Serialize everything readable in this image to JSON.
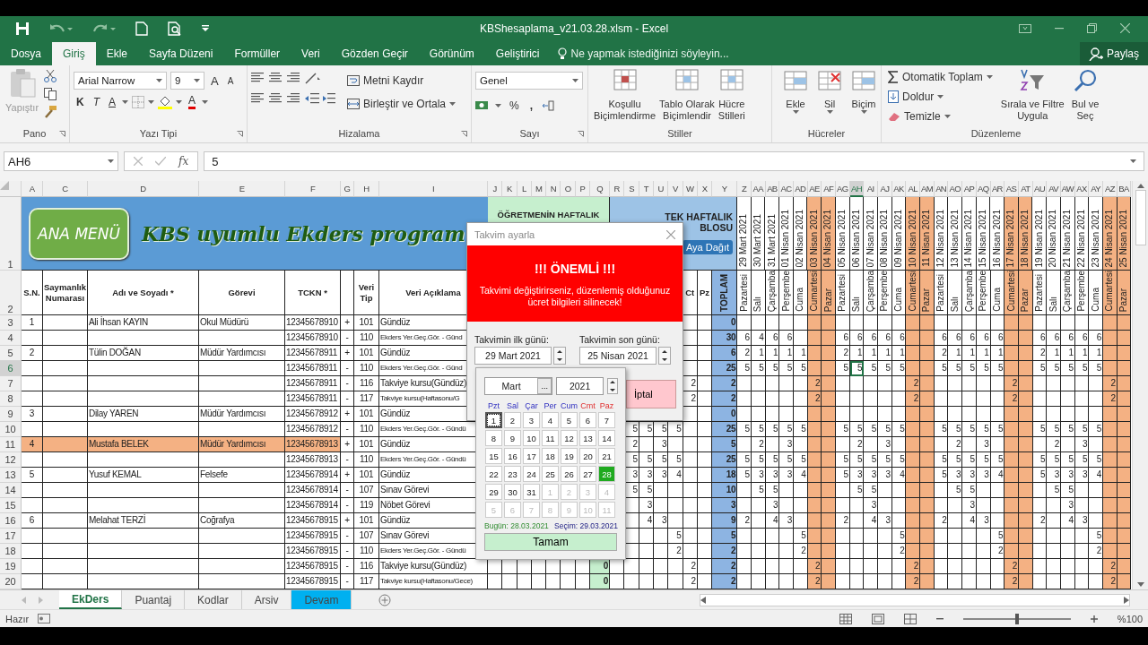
{
  "title_bar": {
    "title": "KBShesaplama_v21.03.28.xlsm - Excel"
  },
  "menu_tabs": [
    {
      "label": "Dosya",
      "selected": false
    },
    {
      "label": "Giriş",
      "selected": true
    },
    {
      "label": "Ekle",
      "selected": false
    },
    {
      "label": "Sayfa Düzeni",
      "selected": false
    },
    {
      "label": "Formüller",
      "selected": false
    },
    {
      "label": "Veri",
      "selected": false
    },
    {
      "label": "Gözden Geçir",
      "selected": false
    },
    {
      "label": "Görünüm",
      "selected": false
    },
    {
      "label": "Geliştirici",
      "selected": false
    }
  ],
  "tell_me": {
    "placeholder": "Ne yapmak istediğinizi söyleyin..."
  },
  "share": "Paylaş",
  "ribbon": {
    "clipboard": {
      "label": "Pano",
      "paste": "Yapıştır"
    },
    "font": {
      "label": "Yazı Tipi",
      "font_name": "Arial Narrow",
      "font_size": "9",
      "grow": "A",
      "shrink": "A",
      "bold": "K",
      "italic": "T",
      "underline": "A",
      "font_color": "A"
    },
    "alignment": {
      "label": "Hizalama",
      "wrap": "Metni Kaydır",
      "merge": "Birleştir ve Ortala"
    },
    "number": {
      "label": "Sayı",
      "format": "Genel",
      "percent": "%",
      "comma": ","
    },
    "styles": {
      "label": "Stiller",
      "buttons": [
        [
          "Koşullu",
          "Biçimlendirme"
        ],
        [
          "Tablo Olarak",
          "Biçimlendir"
        ],
        [
          "Hücre",
          "Stilleri"
        ]
      ]
    },
    "cells": {
      "label": "Hücreler",
      "buttons": [
        "Ekle",
        "Sil",
        "Biçim"
      ]
    },
    "editing": {
      "label": "Düzenleme",
      "autosum": "Otomatik Toplam",
      "fill": "Doldur",
      "clear": "Temizle",
      "sort": [
        "Sırala ve Filtre",
        "Uygula"
      ],
      "find": [
        "Bul ve",
        "Seç"
      ]
    }
  },
  "formula_bar": {
    "name_box": "AH6",
    "fx": "fx",
    "value": "5"
  },
  "sheet": {
    "column_headers": [
      {
        "label": "A",
        "selected": false
      },
      {
        "label": "C",
        "selected": false
      },
      {
        "label": "D",
        "selected": false
      },
      {
        "label": "E",
        "selected": false
      },
      {
        "label": "F",
        "selected": false
      },
      {
        "label": "G",
        "selected": false
      },
      {
        "label": "H",
        "selected": false
      },
      {
        "label": "I",
        "selected": false
      },
      {
        "label": "J",
        "selected": false
      },
      {
        "label": "K",
        "selected": false
      },
      {
        "label": "L",
        "selected": false
      },
      {
        "label": "M",
        "selected": false
      },
      {
        "label": "N",
        "selected": false
      },
      {
        "label": "O",
        "selected": false
      },
      {
        "label": "P",
        "selected": false
      },
      {
        "label": "Q",
        "selected": false
      },
      {
        "label": "R",
        "selected": false
      },
      {
        "label": "S",
        "selected": false
      },
      {
        "label": "T",
        "selected": false
      },
      {
        "label": "U",
        "selected": false
      },
      {
        "label": "V",
        "selected": false
      },
      {
        "label": "W",
        "selected": false
      },
      {
        "label": "X",
        "selected": false
      },
      {
        "label": "Y",
        "selected": false
      },
      {
        "label": "Z",
        "selected": false
      },
      {
        "label": "AA",
        "selected": false
      },
      {
        "label": "AB",
        "selected": false
      },
      {
        "label": "AC",
        "selected": false
      },
      {
        "label": "AD",
        "selected": false
      },
      {
        "label": "AE",
        "selected": false
      },
      {
        "label": "AF",
        "selected": false
      },
      {
        "label": "AG",
        "selected": false
      },
      {
        "label": "AH",
        "selected": true
      },
      {
        "label": "AI",
        "selected": false
      },
      {
        "label": "AJ",
        "selected": false
      },
      {
        "label": "AK",
        "selected": false
      },
      {
        "label": "AL",
        "selected": false
      },
      {
        "label": "AM",
        "selected": false
      },
      {
        "label": "AN",
        "selected": false
      },
      {
        "label": "AO",
        "selected": false
      },
      {
        "label": "AP",
        "selected": false
      },
      {
        "label": "AQ",
        "selected": false
      },
      {
        "label": "AR",
        "selected": false
      },
      {
        "label": "AS",
        "selected": false
      },
      {
        "label": "AT",
        "selected": false
      },
      {
        "label": "AU",
        "selected": false
      },
      {
        "label": "AV",
        "selected": false
      },
      {
        "label": "AW",
        "selected": false
      },
      {
        "label": "AX",
        "selected": false
      },
      {
        "label": "AY",
        "selected": false
      },
      {
        "label": "AZ",
        "selected": false
      },
      {
        "label": "BA",
        "selected": false
      }
    ],
    "banner": {
      "row_number": "1",
      "menu_button": "ANA MENÜ",
      "title": "KBS uyumlu Ekders program",
      "band_1": "ÖĞRETMENİN HAFTALIK",
      "band_2_top": "TEK HAFTALIK",
      "band_2_bottom": "BLOSU",
      "distribute_button": "Aya Dağıt"
    },
    "header_row": {
      "row_number": "2",
      "sn": "S.N.",
      "account": "Saymanlık Numarası",
      "name": "Adı ve Soyadı *",
      "role": "Görevi",
      "tckn": "TCKN *",
      "type": "Veri Tip",
      "desc": "Veri Açıklama",
      "col_w": "Ct",
      "col_x": "Pz",
      "total": "TOPLAM"
    },
    "days": [
      {
        "date": "29 Mart 2021",
        "day": "Pazartesi",
        "weekend": false
      },
      {
        "date": "30 Mart 2021",
        "day": "Salı",
        "weekend": false
      },
      {
        "date": "31 Mart 2021",
        "day": "Çarşamba",
        "weekend": false
      },
      {
        "date": "01 Nisan 2021",
        "day": "Perşembe",
        "weekend": false
      },
      {
        "date": "02 Nisan 2021",
        "day": "Cuma",
        "weekend": false
      },
      {
        "date": "03 Nisan 2021",
        "day": "Cumartesi",
        "weekend": true
      },
      {
        "date": "04 Nisan 2021",
        "day": "Pazar",
        "weekend": true
      },
      {
        "date": "05 Nisan 2021",
        "day": "Pazartesi",
        "weekend": false
      },
      {
        "date": "06 Nisan 2021",
        "day": "Salı",
        "weekend": false
      },
      {
        "date": "07 Nisan 2021",
        "day": "Çarşamba",
        "weekend": false
      },
      {
        "date": "08 Nisan 2021",
        "day": "Perşembe",
        "weekend": false
      },
      {
        "date": "09 Nisan 2021",
        "day": "Cuma",
        "weekend": false
      },
      {
        "date": "10 Nisan 2021",
        "day": "Cumartesi",
        "weekend": true
      },
      {
        "date": "11 Nisan 2021",
        "day": "Pazar",
        "weekend": true
      },
      {
        "date": "12 Nisan 2021",
        "day": "Pazartesi",
        "weekend": false
      },
      {
        "date": "13 Nisan 2021",
        "day": "Salı",
        "weekend": false
      },
      {
        "date": "14 Nisan 2021",
        "day": "Çarşamba",
        "weekend": false
      },
      {
        "date": "15 Nisan 2021",
        "day": "Perşembe",
        "weekend": false
      },
      {
        "date": "16 Nisan 2021",
        "day": "Cuma",
        "weekend": false
      },
      {
        "date": "17 Nisan 2021",
        "day": "Cumartesi",
        "weekend": true
      },
      {
        "date": "18 Nisan 2021",
        "day": "Pazar",
        "weekend": true
      },
      {
        "date": "19 Nisan 2021",
        "day": "Pazartesi",
        "weekend": false
      },
      {
        "date": "20 Nisan 2021",
        "day": "Salı",
        "weekend": false
      },
      {
        "date": "21 Nisan 2021",
        "day": "Çarşamba",
        "weekend": false
      },
      {
        "date": "22 Nisan 2021",
        "day": "Perşembe",
        "weekend": false
      },
      {
        "date": "23 Nisan 2021",
        "day": "Cuma",
        "weekend": false
      },
      {
        "date": "24 Nisan 2021",
        "day": "Cumartesi",
        "weekend": true
      },
      {
        "date": "25 Nisan 2021",
        "day": "Pazar",
        "weekend": true
      }
    ],
    "rows": [
      {
        "number": "3",
        "selected": false,
        "highlighted": false,
        "sn": "1",
        "name": "Ali İhsan KAYIN",
        "role": "Okul Müdürü",
        "tckn": "12345678910",
        "sign": "+",
        "type": "101",
        "desc": "Gündüz",
        "total": "0"
      },
      {
        "number": "4",
        "selected": false,
        "highlighted": false,
        "tckn": "12345678910",
        "sign": "-",
        "type": "110",
        "desc": "Ekders Yer.Geç.Gör. - Günd",
        "total": "30",
        "weeks": [
          {
            "mon": "6",
            "tue": "4",
            "wed": "6",
            "thu": "6"
          },
          {
            "mon": "6",
            "tue": "6",
            "wed": "6",
            "thu": "6",
            "fri": "6"
          },
          {
            "mon": "6",
            "tue": "6",
            "wed": "6",
            "thu": "6",
            "fri": "6"
          },
          {
            "mon": "6",
            "tue": "6",
            "wed": "6",
            "thu": "6",
            "fri": "6"
          }
        ]
      },
      {
        "number": "5",
        "selected": false,
        "highlighted": false,
        "sn": "2",
        "name": "Tülin DOĞAN",
        "role": "Müdür Yardımcısı",
        "tckn": "12345678911",
        "sign": "+",
        "type": "101",
        "desc": "Gündüz",
        "total": "6",
        "weeks": [
          {
            "mon": "2",
            "tue": "1",
            "wed": "1",
            "thu": "1",
            "fri": "1"
          },
          {
            "mon": "2",
            "tue": "1",
            "wed": "1",
            "thu": "1",
            "fri": "1"
          },
          {
            "mon": "2",
            "tue": "1",
            "wed": "1",
            "thu": "1",
            "fri": "1"
          },
          {
            "mon": "2",
            "tue": "1",
            "wed": "1",
            "thu": "1",
            "fri": "1"
          }
        ]
      },
      {
        "number": "6",
        "selected": true,
        "highlighted": false,
        "tckn": "12345678911",
        "sign": "-",
        "type": "110",
        "desc": "Ekders Yer.Geç.Gör. - Günd",
        "total": "25",
        "weeks": [
          {
            "mon": "5",
            "tue": "5",
            "wed": "5",
            "thu": "5",
            "fri": "5"
          },
          {
            "mon": "5",
            "tue": "5",
            "wed": "5",
            "thu": "5",
            "fri": "5"
          },
          {
            "mon": "5",
            "tue": "5",
            "wed": "5",
            "thu": "5",
            "fri": "5"
          },
          {
            "mon": "5",
            "tue": "5",
            "wed": "5",
            "thu": "5",
            "fri": "5"
          }
        ]
      },
      {
        "number": "7",
        "selected": false,
        "highlighted": false,
        "tckn": "12345678911",
        "sign": "-",
        "type": "116",
        "desc": "Takviye kursu(Gündüz)",
        "cells": {
          "W": "2"
        },
        "total": "2",
        "weeks": [
          {
            "sat": "2"
          },
          {
            "sat": "2"
          },
          {
            "sat": "2"
          },
          {
            "sat": "2"
          }
        ]
      },
      {
        "number": "8",
        "selected": false,
        "highlighted": false,
        "tckn": "12345678911",
        "sign": "-",
        "type": "117",
        "desc": "Takviye kursu(Haftasonu/G",
        "cells": {
          "W": "2"
        },
        "total": "2",
        "weeks": [
          {
            "sat": "2"
          },
          {
            "sat": "2"
          },
          {
            "sat": "2"
          },
          {
            "sat": "2"
          }
        ]
      },
      {
        "number": "9",
        "selected": false,
        "highlighted": false,
        "sn": "3",
        "name": "Dilay YAREN",
        "role": "Müdür Yardımcısı",
        "tckn": "12345678912",
        "sign": "+",
        "type": "101",
        "desc": "Gündüz",
        "total": "0"
      },
      {
        "number": "10",
        "selected": false,
        "highlighted": false,
        "tckn": "12345678912",
        "sign": "-",
        "type": "110",
        "desc": "Ekders Yer.Geç.Gör. - Gündü",
        "cells": {
          "S": "5",
          "T": "5",
          "U": "5",
          "V": "5"
        },
        "total": "25",
        "weeks": [
          {
            "mon": "5",
            "tue": "5",
            "wed": "5",
            "thu": "5",
            "fri": "5"
          },
          {
            "mon": "5",
            "tue": "5",
            "wed": "5",
            "thu": "5",
            "fri": "5"
          },
          {
            "mon": "5",
            "tue": "5",
            "wed": "5",
            "thu": "5",
            "fri": "5"
          },
          {
            "mon": "5",
            "tue": "5",
            "wed": "5",
            "thu": "5",
            "fri": "5"
          }
        ]
      },
      {
        "number": "11",
        "selected": false,
        "highlighted": true,
        "sn": "4",
        "name": "Mustafa BELEK",
        "role": "Müdür Yardımcısı",
        "tckn": "12345678913",
        "sign": "+",
        "type": "101",
        "desc": "Gündüz",
        "cells": {
          "S": "2",
          "U": "3"
        },
        "total": "5",
        "weeks": [
          {
            "tue": "2",
            "thu": "3"
          },
          {
            "tue": "2",
            "thu": "3"
          },
          {
            "tue": "2",
            "thu": "3"
          },
          {
            "tue": "2",
            "thu": "3"
          }
        ]
      },
      {
        "number": "12",
        "selected": false,
        "highlighted": false,
        "tckn": "12345678913",
        "sign": "-",
        "type": "110",
        "desc": "Ekders Yer.Geç.Gör. - Gündü",
        "cells": {
          "S": "5",
          "T": "5",
          "U": "5",
          "V": "5"
        },
        "total": "25",
        "weeks": [
          {
            "mon": "5",
            "tue": "5",
            "wed": "5",
            "thu": "5",
            "fri": "5"
          },
          {
            "mon": "5",
            "tue": "5",
            "wed": "5",
            "thu": "5",
            "fri": "5"
          },
          {
            "mon": "5",
            "tue": "5",
            "wed": "5",
            "thu": "5",
            "fri": "5"
          },
          {
            "mon": "5",
            "tue": "5",
            "wed": "5",
            "thu": "5",
            "fri": "5"
          }
        ]
      },
      {
        "number": "13",
        "selected": false,
        "highlighted": false,
        "sn": "5",
        "name": "Yusuf KEMAL",
        "role": "Felsefe",
        "tckn": "12345678914",
        "sign": "+",
        "type": "101",
        "desc": "Gündüz",
        "cells": {
          "S": "3",
          "T": "3",
          "U": "3",
          "V": "4"
        },
        "total": "18",
        "weeks": [
          {
            "mon": "5",
            "tue": "3",
            "wed": "3",
            "thu": "3",
            "fri": "4"
          },
          {
            "mon": "5",
            "tue": "3",
            "wed": "3",
            "thu": "3",
            "fri": "4"
          },
          {
            "mon": "5",
            "tue": "3",
            "wed": "3",
            "thu": "3",
            "fri": "4"
          },
          {
            "mon": "5",
            "tue": "3",
            "wed": "3",
            "thu": "3",
            "fri": "4"
          }
        ]
      },
      {
        "number": "14",
        "selected": false,
        "highlighted": false,
        "tckn": "12345678914",
        "sign": "-",
        "type": "107",
        "desc": "Sınav Görevi",
        "cells": {
          "S": "5",
          "T": "5"
        },
        "total": "10",
        "weeks": [
          {
            "tue": "5",
            "wed": "5"
          },
          {
            "tue": "5",
            "wed": "5"
          },
          {
            "tue": "5",
            "wed": "5"
          },
          {
            "tue": "5",
            "wed": "5"
          }
        ]
      },
      {
        "number": "15",
        "selected": false,
        "highlighted": false,
        "tckn": "12345678914",
        "sign": "-",
        "type": "119",
        "desc": "Nöbet Görevi",
        "cells": {
          "T": "3"
        },
        "total": "3",
        "weeks": [
          {
            "wed": "3"
          },
          {
            "wed": "3"
          },
          {
            "wed": "3"
          },
          {
            "wed": "3"
          }
        ]
      },
      {
        "number": "16",
        "selected": false,
        "highlighted": false,
        "sn": "6",
        "name": "Melahat TERZİ",
        "role": "Coğrafya",
        "tckn": "12345678915",
        "sign": "+",
        "type": "101",
        "desc": "Gündüz",
        "cells": {
          "T": "4",
          "U": "3"
        },
        "total": "9",
        "weeks": [
          {
            "mon": "2",
            "wed": "4",
            "thu": "3"
          },
          {
            "mon": "2",
            "wed": "4",
            "thu": "3"
          },
          {
            "mon": "2",
            "wed": "4",
            "thu": "3"
          },
          {
            "mon": "2",
            "wed": "4",
            "thu": "3"
          }
        ]
      },
      {
        "number": "17",
        "selected": false,
        "highlighted": false,
        "tckn": "12345678915",
        "sign": "-",
        "type": "107",
        "desc": "Sınav Görevi",
        "cells": {
          "V": "5"
        },
        "total": "5",
        "weeks": [
          {
            "fri": "5"
          },
          {
            "fri": "5"
          },
          {
            "fri": "5"
          },
          {
            "fri": "5"
          }
        ]
      },
      {
        "number": "18",
        "selected": false,
        "highlighted": false,
        "tckn": "12345678915",
        "sign": "-",
        "type": "110",
        "desc": "Ekders Yer.Geç.Gör. - Gündü",
        "cells": {
          "V": "2"
        },
        "total": "2",
        "weeks": [
          {
            "fri": "2"
          },
          {
            "fri": "2"
          },
          {
            "fri": "2"
          },
          {
            "fri": "2"
          }
        ]
      },
      {
        "number": "19",
        "selected": false,
        "highlighted": false,
        "tckn": "12345678915",
        "sign": "-",
        "type": "116",
        "desc": "Takviye kursu(Gündüz)",
        "cells": {
          "Q": "0",
          "W": "2"
        },
        "total": "2",
        "weeks": [
          {
            "sat": "2"
          },
          {
            "sat": "2"
          },
          {
            "sat": "2"
          },
          {
            "sat": "2"
          }
        ]
      },
      {
        "number": "20",
        "selected": false,
        "highlighted": false,
        "tckn": "12345678915",
        "sign": "-",
        "type": "117",
        "desc": "Takviye kursu(Haftasonu/Gece)",
        "cells": {
          "Q": "0",
          "W": "2"
        },
        "total": "2",
        "weeks": [
          {
            "sat": "2"
          },
          {
            "sat": "2"
          },
          {
            "sat": "2"
          },
          {
            "sat": "2"
          }
        ]
      }
    ]
  },
  "dialog": {
    "title": "Takvim ayarla",
    "warning_title": "!!! ÖNEMLİ !!!",
    "warning_text": "Takvimi değiştirirseniz, düzenlemiş olduğunuz ücret bilgileri silinecek!",
    "start_label": "Takvimin ilk günü:",
    "start_value": "29 Mart 2021",
    "end_label": "Takvimin son günü:",
    "end_value": "25 Nisan 2021",
    "cancel": "İptal"
  },
  "calendar": {
    "month": "Mart",
    "more": "...",
    "year": "2021",
    "weekdays": [
      {
        "label": "Pzt",
        "weekend": false
      },
      {
        "label": "Sal",
        "weekend": false
      },
      {
        "label": "Çar",
        "weekend": false
      },
      {
        "label": "Per",
        "weekend": false
      },
      {
        "label": "Cum",
        "weekend": false
      },
      {
        "label": "Cmt",
        "weekend": true
      },
      {
        "label": "Paz",
        "weekend": true
      }
    ],
    "days": [
      {
        "label": "1",
        "outside": false,
        "today": false,
        "focused": true
      },
      {
        "label": "2",
        "outside": false,
        "today": false,
        "focused": false
      },
      {
        "label": "3",
        "outside": false,
        "today": false,
        "focused": false
      },
      {
        "label": "4",
        "outside": false,
        "today": false,
        "focused": false
      },
      {
        "label": "5",
        "outside": false,
        "today": false,
        "focused": false
      },
      {
        "label": "6",
        "outside": false,
        "today": false,
        "focused": false
      },
      {
        "label": "7",
        "outside": false,
        "today": false,
        "focused": false
      },
      {
        "label": "8",
        "outside": false,
        "today": false,
        "focused": false
      },
      {
        "label": "9",
        "outside": false,
        "today": false,
        "focused": false
      },
      {
        "label": "10",
        "outside": false,
        "today": false,
        "focused": false
      },
      {
        "label": "11",
        "outside": false,
        "today": false,
        "focused": false
      },
      {
        "label": "12",
        "outside": false,
        "today": false,
        "focused": false
      },
      {
        "label": "13",
        "outside": false,
        "today": false,
        "focused": false
      },
      {
        "label": "14",
        "outside": false,
        "today": false,
        "focused": false
      },
      {
        "label": "15",
        "outside": false,
        "today": false,
        "focused": false
      },
      {
        "label": "16",
        "outside": false,
        "today": false,
        "focused": false
      },
      {
        "label": "17",
        "outside": false,
        "today": false,
        "focused": false
      },
      {
        "label": "18",
        "outside": false,
        "today": false,
        "focused": false
      },
      {
        "label": "19",
        "outside": false,
        "today": false,
        "focused": false
      },
      {
        "label": "20",
        "outside": false,
        "today": false,
        "focused": false
      },
      {
        "label": "21",
        "outside": false,
        "today": false,
        "focused": false
      },
      {
        "label": "22",
        "outside": false,
        "today": false,
        "focused": false
      },
      {
        "label": "23",
        "outside": false,
        "today": false,
        "focused": false
      },
      {
        "label": "24",
        "outside": false,
        "today": false,
        "focused": false
      },
      {
        "label": "25",
        "outside": false,
        "today": false,
        "focused": false
      },
      {
        "label": "26",
        "outside": false,
        "today": false,
        "focused": false
      },
      {
        "label": "27",
        "outside": false,
        "today": false,
        "focused": false
      },
      {
        "label": "28",
        "outside": false,
        "today": true,
        "focused": false
      },
      {
        "label": "29",
        "outside": false,
        "today": false,
        "focused": false
      },
      {
        "label": "30",
        "outside": false,
        "today": false,
        "focused": false
      },
      {
        "label": "31",
        "outside": false,
        "today": false,
        "focused": false
      },
      {
        "label": "1",
        "outside": true,
        "today": false,
        "focused": false
      },
      {
        "label": "2",
        "outside": true,
        "today": false,
        "focused": false
      },
      {
        "label": "3",
        "outside": true,
        "today": false,
        "focused": false
      },
      {
        "label": "4",
        "outside": true,
        "today": false,
        "focused": false
      },
      {
        "label": "5",
        "outside": true,
        "today": false,
        "focused": false
      },
      {
        "label": "6",
        "outside": true,
        "today": false,
        "focused": false
      },
      {
        "label": "7",
        "outside": true,
        "today": false,
        "focused": false
      },
      {
        "label": "8",
        "outside": true,
        "today": false,
        "focused": false
      },
      {
        "label": "9",
        "outside": true,
        "today": false,
        "focused": false
      },
      {
        "label": "10",
        "outside": true,
        "today": false,
        "focused": false
      },
      {
        "label": "11",
        "outside": true,
        "today": false,
        "focused": false
      }
    ],
    "today_text": "Bugün: 28.03.2021",
    "selection_text": "Seçim: 29.03.2021",
    "ok": "Tamam"
  },
  "sheet_tabs": [
    {
      "label": "EkDers",
      "selected": true
    },
    {
      "label": "Puantaj",
      "selected": false
    },
    {
      "label": "Kodlar",
      "selected": false
    },
    {
      "label": "Arsiv",
      "selected": false
    },
    {
      "label": "Devam",
      "selected": false,
      "color": "#00b0f0"
    }
  ],
  "status_bar": {
    "status": "Hazır",
    "zoom": "%100",
    "zoom_slider": {
      "level": 0.5
    }
  }
}
